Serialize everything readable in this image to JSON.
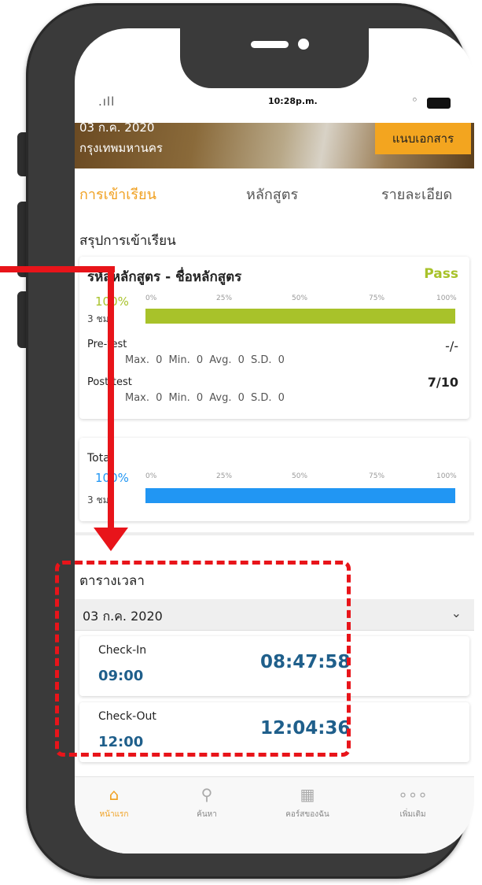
{
  "status_bar": {
    "signal": ".ıll",
    "time": "10:28p.m."
  },
  "banner": {
    "line1": "03 ก.ค. 2020",
    "line2": "กรุงเทพมหานคร",
    "doc_button": "แนบเอกสาร"
  },
  "tabs": [
    {
      "label": "การเข้าเรียน",
      "active": true
    },
    {
      "label": "หลักสูตร",
      "active": false
    },
    {
      "label": "รายละเอียด",
      "active": false
    }
  ],
  "summary": {
    "title": "สรุปการเข้าเรียน",
    "course_name": "รหัสหลักสูตร - ชื่อหลักสูตร",
    "status": "Pass",
    "percent": "100%",
    "hours": "3 ชม.",
    "progress": 1.0,
    "ticks": [
      "0%",
      "25%",
      "50%",
      "75%",
      "100%"
    ],
    "pretest": {
      "label": "Pre-test",
      "stats": "Max. 0 Min. 0 Avg. 0 S.D. 0",
      "score": "-/-"
    },
    "posttest": {
      "label": "Post-test",
      "stats": "Max. 0 Min. 0 Avg. 0 S.D. 0",
      "score": "7/10"
    }
  },
  "total": {
    "label": "Total",
    "percent": "100%",
    "hours": "3 ชม.",
    "progress": 1.0,
    "ticks": [
      "0%",
      "25%",
      "50%",
      "75%",
      "100%"
    ]
  },
  "schedule": {
    "title": "ตารางเวลา",
    "date": "03 ก.ค. 2020",
    "check_in": {
      "label": "Check-In",
      "scheduled": "09:00",
      "actual": "08:47:58"
    },
    "check_out": {
      "label": "Check-Out",
      "scheduled": "12:00",
      "actual": "12:04:36"
    }
  },
  "bottom_nav": [
    {
      "label": "หน้าแรก",
      "icon": "home-icon",
      "active": true
    },
    {
      "label": "ค้นหา",
      "icon": "search-icon",
      "active": false
    },
    {
      "label": "คอร์สของฉัน",
      "icon": "my-course-icon",
      "active": false
    },
    {
      "label": "เพิ่มเติม",
      "icon": "more-icon",
      "active": false
    }
  ],
  "colors": {
    "accent": "#f0a020",
    "pass_green": "#a8c22a",
    "total_blue": "#2196f3",
    "time_blue": "#1f5f8b",
    "annotation_red": "#e8141a"
  }
}
